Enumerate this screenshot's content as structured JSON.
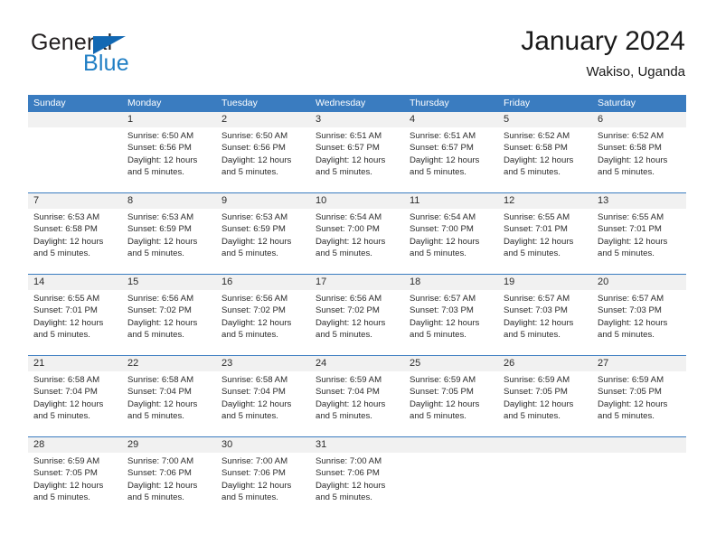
{
  "brand": {
    "name_part1": "General",
    "name_part2": "Blue",
    "logo_icon": "blue-triangle-icon",
    "color_dark": "#231f20",
    "color_blue": "#1f7ec4"
  },
  "header": {
    "title": "January 2024",
    "subtitle": "Wakiso, Uganda"
  },
  "theme": {
    "header_blue": "#3a7cc0",
    "number_band": "#f1f1f1",
    "text": "#2b2b2b"
  },
  "weekday_headers": [
    "Sunday",
    "Monday",
    "Tuesday",
    "Wednesday",
    "Thursday",
    "Friday",
    "Saturday"
  ],
  "weeks": [
    {
      "numbers": [
        "",
        "1",
        "2",
        "3",
        "4",
        "5",
        "6"
      ],
      "cells": [
        {
          "lines": []
        },
        {
          "lines": [
            "Sunrise: 6:50 AM",
            "Sunset: 6:56 PM",
            "Daylight: 12 hours",
            "and 5 minutes."
          ]
        },
        {
          "lines": [
            "Sunrise: 6:50 AM",
            "Sunset: 6:56 PM",
            "Daylight: 12 hours",
            "and 5 minutes."
          ]
        },
        {
          "lines": [
            "Sunrise: 6:51 AM",
            "Sunset: 6:57 PM",
            "Daylight: 12 hours",
            "and 5 minutes."
          ]
        },
        {
          "lines": [
            "Sunrise: 6:51 AM",
            "Sunset: 6:57 PM",
            "Daylight: 12 hours",
            "and 5 minutes."
          ]
        },
        {
          "lines": [
            "Sunrise: 6:52 AM",
            "Sunset: 6:58 PM",
            "Daylight: 12 hours",
            "and 5 minutes."
          ]
        },
        {
          "lines": [
            "Sunrise: 6:52 AM",
            "Sunset: 6:58 PM",
            "Daylight: 12 hours",
            "and 5 minutes."
          ]
        }
      ]
    },
    {
      "numbers": [
        "7",
        "8",
        "9",
        "10",
        "11",
        "12",
        "13"
      ],
      "cells": [
        {
          "lines": [
            "Sunrise: 6:53 AM",
            "Sunset: 6:58 PM",
            "Daylight: 12 hours",
            "and 5 minutes."
          ]
        },
        {
          "lines": [
            "Sunrise: 6:53 AM",
            "Sunset: 6:59 PM",
            "Daylight: 12 hours",
            "and 5 minutes."
          ]
        },
        {
          "lines": [
            "Sunrise: 6:53 AM",
            "Sunset: 6:59 PM",
            "Daylight: 12 hours",
            "and 5 minutes."
          ]
        },
        {
          "lines": [
            "Sunrise: 6:54 AM",
            "Sunset: 7:00 PM",
            "Daylight: 12 hours",
            "and 5 minutes."
          ]
        },
        {
          "lines": [
            "Sunrise: 6:54 AM",
            "Sunset: 7:00 PM",
            "Daylight: 12 hours",
            "and 5 minutes."
          ]
        },
        {
          "lines": [
            "Sunrise: 6:55 AM",
            "Sunset: 7:01 PM",
            "Daylight: 12 hours",
            "and 5 minutes."
          ]
        },
        {
          "lines": [
            "Sunrise: 6:55 AM",
            "Sunset: 7:01 PM",
            "Daylight: 12 hours",
            "and 5 minutes."
          ]
        }
      ]
    },
    {
      "numbers": [
        "14",
        "15",
        "16",
        "17",
        "18",
        "19",
        "20"
      ],
      "cells": [
        {
          "lines": [
            "Sunrise: 6:55 AM",
            "Sunset: 7:01 PM",
            "Daylight: 12 hours",
            "and 5 minutes."
          ]
        },
        {
          "lines": [
            "Sunrise: 6:56 AM",
            "Sunset: 7:02 PM",
            "Daylight: 12 hours",
            "and 5 minutes."
          ]
        },
        {
          "lines": [
            "Sunrise: 6:56 AM",
            "Sunset: 7:02 PM",
            "Daylight: 12 hours",
            "and 5 minutes."
          ]
        },
        {
          "lines": [
            "Sunrise: 6:56 AM",
            "Sunset: 7:02 PM",
            "Daylight: 12 hours",
            "and 5 minutes."
          ]
        },
        {
          "lines": [
            "Sunrise: 6:57 AM",
            "Sunset: 7:03 PM",
            "Daylight: 12 hours",
            "and 5 minutes."
          ]
        },
        {
          "lines": [
            "Sunrise: 6:57 AM",
            "Sunset: 7:03 PM",
            "Daylight: 12 hours",
            "and 5 minutes."
          ]
        },
        {
          "lines": [
            "Sunrise: 6:57 AM",
            "Sunset: 7:03 PM",
            "Daylight: 12 hours",
            "and 5 minutes."
          ]
        }
      ]
    },
    {
      "numbers": [
        "21",
        "22",
        "23",
        "24",
        "25",
        "26",
        "27"
      ],
      "cells": [
        {
          "lines": [
            "Sunrise: 6:58 AM",
            "Sunset: 7:04 PM",
            "Daylight: 12 hours",
            "and 5 minutes."
          ]
        },
        {
          "lines": [
            "Sunrise: 6:58 AM",
            "Sunset: 7:04 PM",
            "Daylight: 12 hours",
            "and 5 minutes."
          ]
        },
        {
          "lines": [
            "Sunrise: 6:58 AM",
            "Sunset: 7:04 PM",
            "Daylight: 12 hours",
            "and 5 minutes."
          ]
        },
        {
          "lines": [
            "Sunrise: 6:59 AM",
            "Sunset: 7:04 PM",
            "Daylight: 12 hours",
            "and 5 minutes."
          ]
        },
        {
          "lines": [
            "Sunrise: 6:59 AM",
            "Sunset: 7:05 PM",
            "Daylight: 12 hours",
            "and 5 minutes."
          ]
        },
        {
          "lines": [
            "Sunrise: 6:59 AM",
            "Sunset: 7:05 PM",
            "Daylight: 12 hours",
            "and 5 minutes."
          ]
        },
        {
          "lines": [
            "Sunrise: 6:59 AM",
            "Sunset: 7:05 PM",
            "Daylight: 12 hours",
            "and 5 minutes."
          ]
        }
      ]
    },
    {
      "numbers": [
        "28",
        "29",
        "30",
        "31",
        "",
        "",
        ""
      ],
      "cells": [
        {
          "lines": [
            "Sunrise: 6:59 AM",
            "Sunset: 7:05 PM",
            "Daylight: 12 hours",
            "and 5 minutes."
          ]
        },
        {
          "lines": [
            "Sunrise: 7:00 AM",
            "Sunset: 7:06 PM",
            "Daylight: 12 hours",
            "and 5 minutes."
          ]
        },
        {
          "lines": [
            "Sunrise: 7:00 AM",
            "Sunset: 7:06 PM",
            "Daylight: 12 hours",
            "and 5 minutes."
          ]
        },
        {
          "lines": [
            "Sunrise: 7:00 AM",
            "Sunset: 7:06 PM",
            "Daylight: 12 hours",
            "and 5 minutes."
          ]
        },
        {
          "lines": []
        },
        {
          "lines": []
        },
        {
          "lines": []
        }
      ]
    }
  ]
}
